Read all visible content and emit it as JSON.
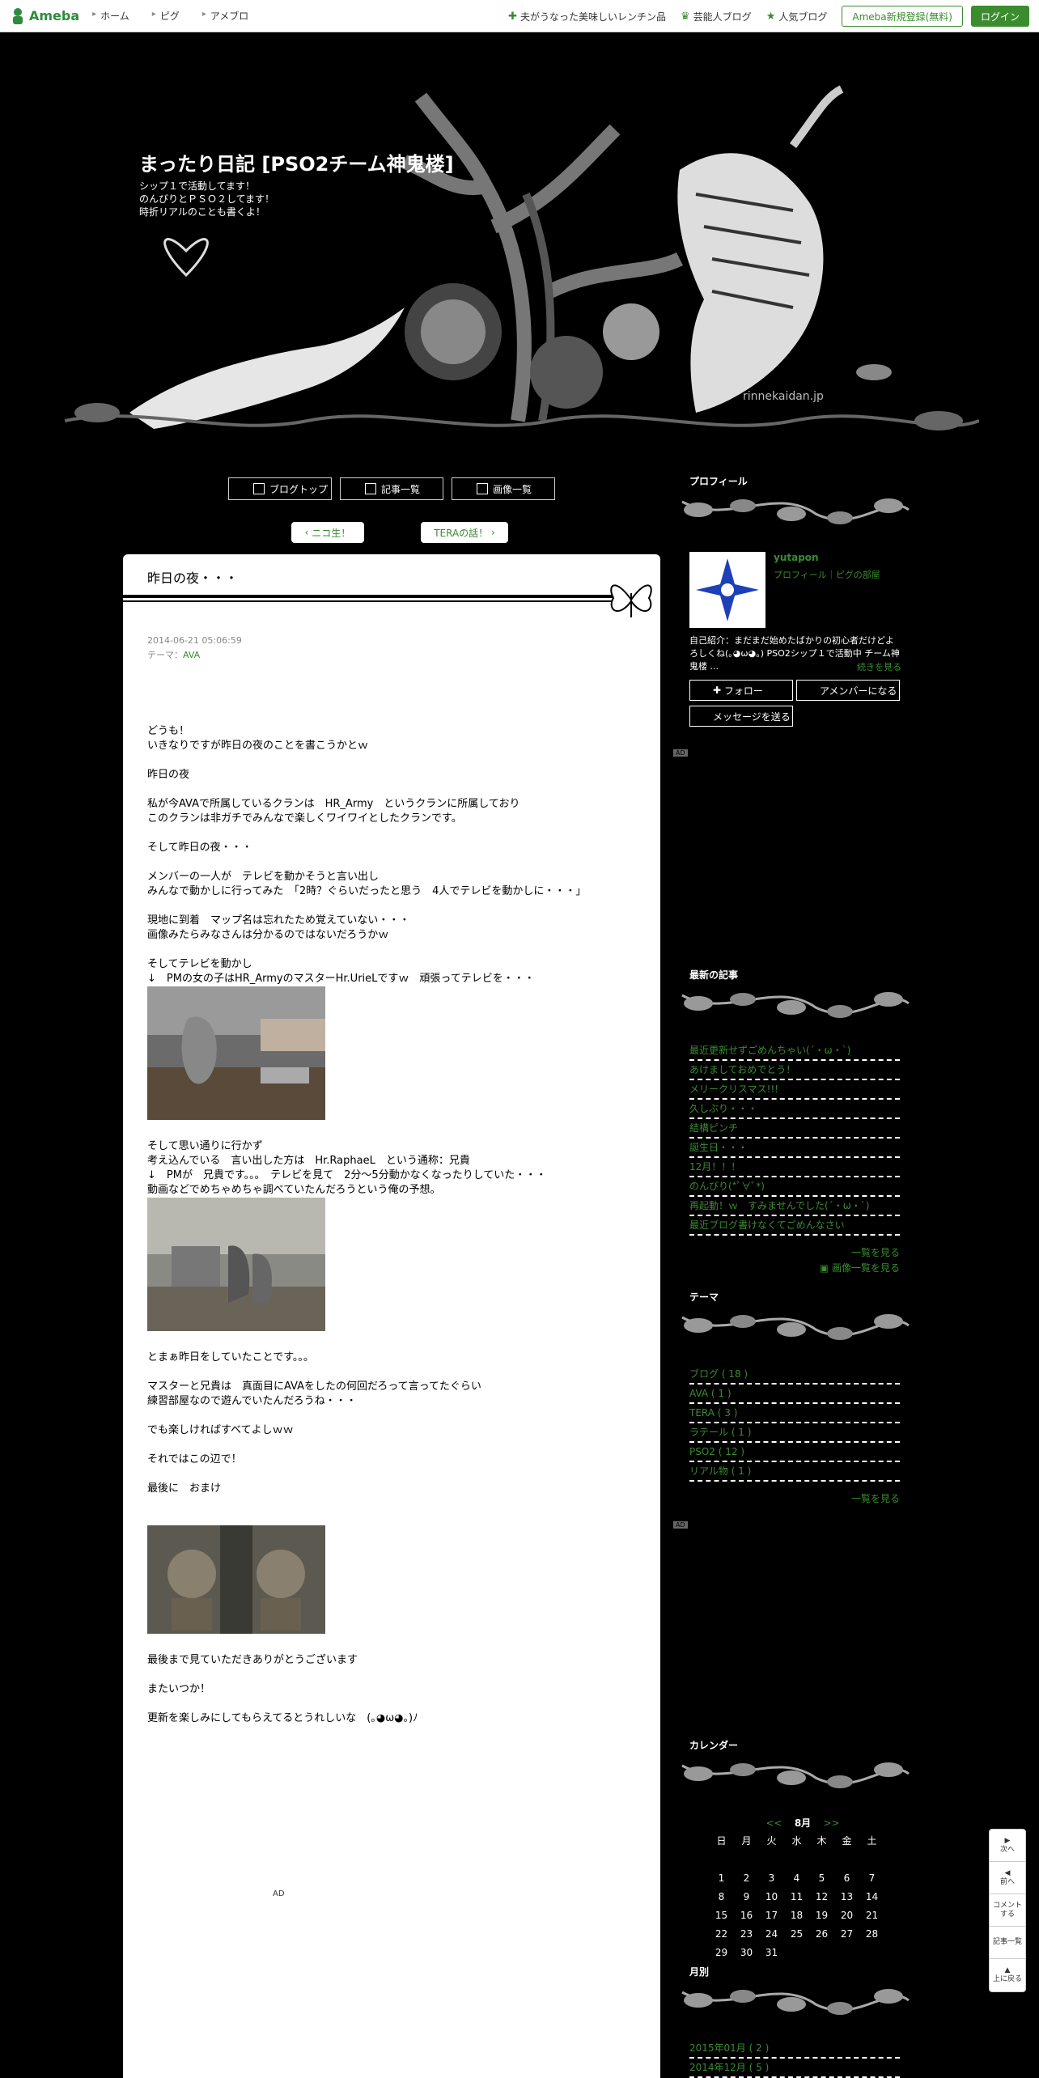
{
  "global_bar": {
    "logo": "Ameba",
    "nav": [
      "ホーム",
      "ピグ",
      "アメブロ"
    ],
    "links": [
      {
        "icon": "sparkle-icon",
        "label": "夫がうなった美味しいレンチン品"
      },
      {
        "icon": "crown-icon",
        "label": "芸能人ブログ"
      },
      {
        "icon": "star-icon",
        "label": "人気ブログ"
      }
    ],
    "register": "Ameba新規登録(無料)",
    "login": "ログイン"
  },
  "header": {
    "title": "まったり日記 [PSO2チーム神鬼楼]",
    "description": "シップ１で活動してます！\nのんびりとＰＳＯ２してます！\n時折リアルのことも書くよ！",
    "watermark": "rinnekaidan.jp"
  },
  "blog_nav": [
    "ブログトップ",
    "記事一覧",
    "画像一覧"
  ],
  "page_nav": {
    "prev": "ニコ生！",
    "next": "TERAの話！"
  },
  "article": {
    "title": "昨日の夜・・・",
    "date": "2014-06-21 05:06:59",
    "theme_label": "テーマ：",
    "theme": "AVA",
    "paragraphs": [
      "どうも！",
      "いきなりですが昨日の夜のことを書こうかとｗ",
      "",
      "昨日の夜",
      "",
      "私が今AVAで所属しているクランは　HR_Army　というクランに所属しており",
      "このクランは非ガチでみんなで楽しくワイワイとしたクランです。",
      "",
      "そして昨日の夜・・・",
      "",
      "メンバーの一人が　テレビを動かそうと言い出し",
      "みんなで動かしに行ってみた　「2時？ぐらいだったと思う　4人でテレビを動かしに・・・」",
      "",
      "現地に到着　マップ名は忘れたため覚えていない・・・",
      "画像みたらみなさんは分かるのではないだろうかｗ",
      "",
      "そしてテレビを動かし",
      "↓　PMの女の子はHR_ArmyのマスターHr.UrieLですｗ　頑張ってテレビを・・・"
    ],
    "paragraphs2": [
      "",
      "そして思い通りに行かず",
      "考え込んでいる　言い出した方は　Hr.RaphaeL　という通称：兄貴",
      "↓　PMが　兄貴です。。。　テレビを見て　2分～5分動かなくなったりしていた・・・",
      "動画などでめちゃめちゃ調べていたんだろうという俺の予想。"
    ],
    "paragraphs3": [
      "",
      "とまぁ昨日をしていたことです。。。",
      "",
      "マスターと兄貴は　真面目にAVAをしたの何回だろって言ってたぐらい",
      "練習部屋なので遊んでいたんだろうね・・・",
      "",
      "でも楽しければすべてよしｗｗ",
      "",
      "それではこの辺で！",
      "",
      "最後に　おまけ",
      "",
      ""
    ],
    "paragraphs4": [
      "",
      "最後まで見ていただきありがとうございます",
      "",
      "またいつか！",
      "",
      "更新を楽しみにしてもらえてるとうれしいな　(｡◕ω◕｡)ﾉ"
    ],
    "ad": "AD"
  },
  "sidebar": {
    "profile": {
      "heading": "プロフィール",
      "name": "yutapon",
      "links": "プロフィール｜ピグの部屋",
      "intro": "自己紹介：まだまだ始めたばかりの初心者だけどよろしくね(｡◕ω◕｡) PSO2シップ１で活動中 チーム神鬼楼 ...",
      "more": "続きを見る",
      "follow": "フォロー",
      "member": "アメンバーになる",
      "message": "メッセージを送る",
      "ad": "AD"
    },
    "recent": {
      "heading": "最新の記事",
      "items": [
        "最近更新せずごめんちゃい(´・ω・`)",
        "あけましておめでとう！",
        "メリークリスマス!!!",
        "久しぶり・・・",
        "結構ピンチ",
        "誕生日・・・",
        "12月！！！",
        "のんびり(*ﾟ∀ﾟ*)",
        "再起動！ｗ　すみませんでした(´・ω・`)",
        "最近ブログ書けなくてごめんなさい"
      ],
      "more": "一覧を見る",
      "images": "画像一覧を見る"
    },
    "theme": {
      "heading": "テーマ",
      "items": [
        "ブログ ( 18 )",
        "AVA ( 1 )",
        "TERA ( 3 )",
        "ラテール ( 1 )",
        "PSO2 ( 12 )",
        "リアル物 ( 1 )"
      ],
      "more": "一覧を見る",
      "ad": "AD"
    },
    "calendar": {
      "heading": "カレンダー",
      "prev": "<<",
      "month": "8月",
      "next": ">>",
      "weekdays": [
        "日",
        "月",
        "火",
        "水",
        "木",
        "金",
        "土"
      ],
      "days": [
        "",
        "",
        "",
        "",
        "",
        "",
        "",
        "",
        "1",
        "2",
        "3",
        "4",
        "5",
        "6",
        "7",
        "8",
        "9",
        "10",
        "11",
        "12",
        "13",
        "14",
        "15",
        "16",
        "17",
        "18",
        "19",
        "20",
        "21",
        "22",
        "23",
        "24",
        "25",
        "26",
        "27",
        "28",
        "29",
        "30",
        "31"
      ]
    },
    "monthly": {
      "heading": "月別",
      "items": [
        "2015年01月 ( 2 )",
        "2014年12月 ( 5 )"
      ]
    }
  },
  "float_nav": [
    {
      "icon": "▶",
      "label": "次へ"
    },
    {
      "icon": "◀",
      "label": "前へ"
    },
    {
      "icon": "",
      "label": "コメントする"
    },
    {
      "icon": "",
      "label": "記事一覧"
    },
    {
      "icon": "▲",
      "label": "上に戻る"
    }
  ]
}
